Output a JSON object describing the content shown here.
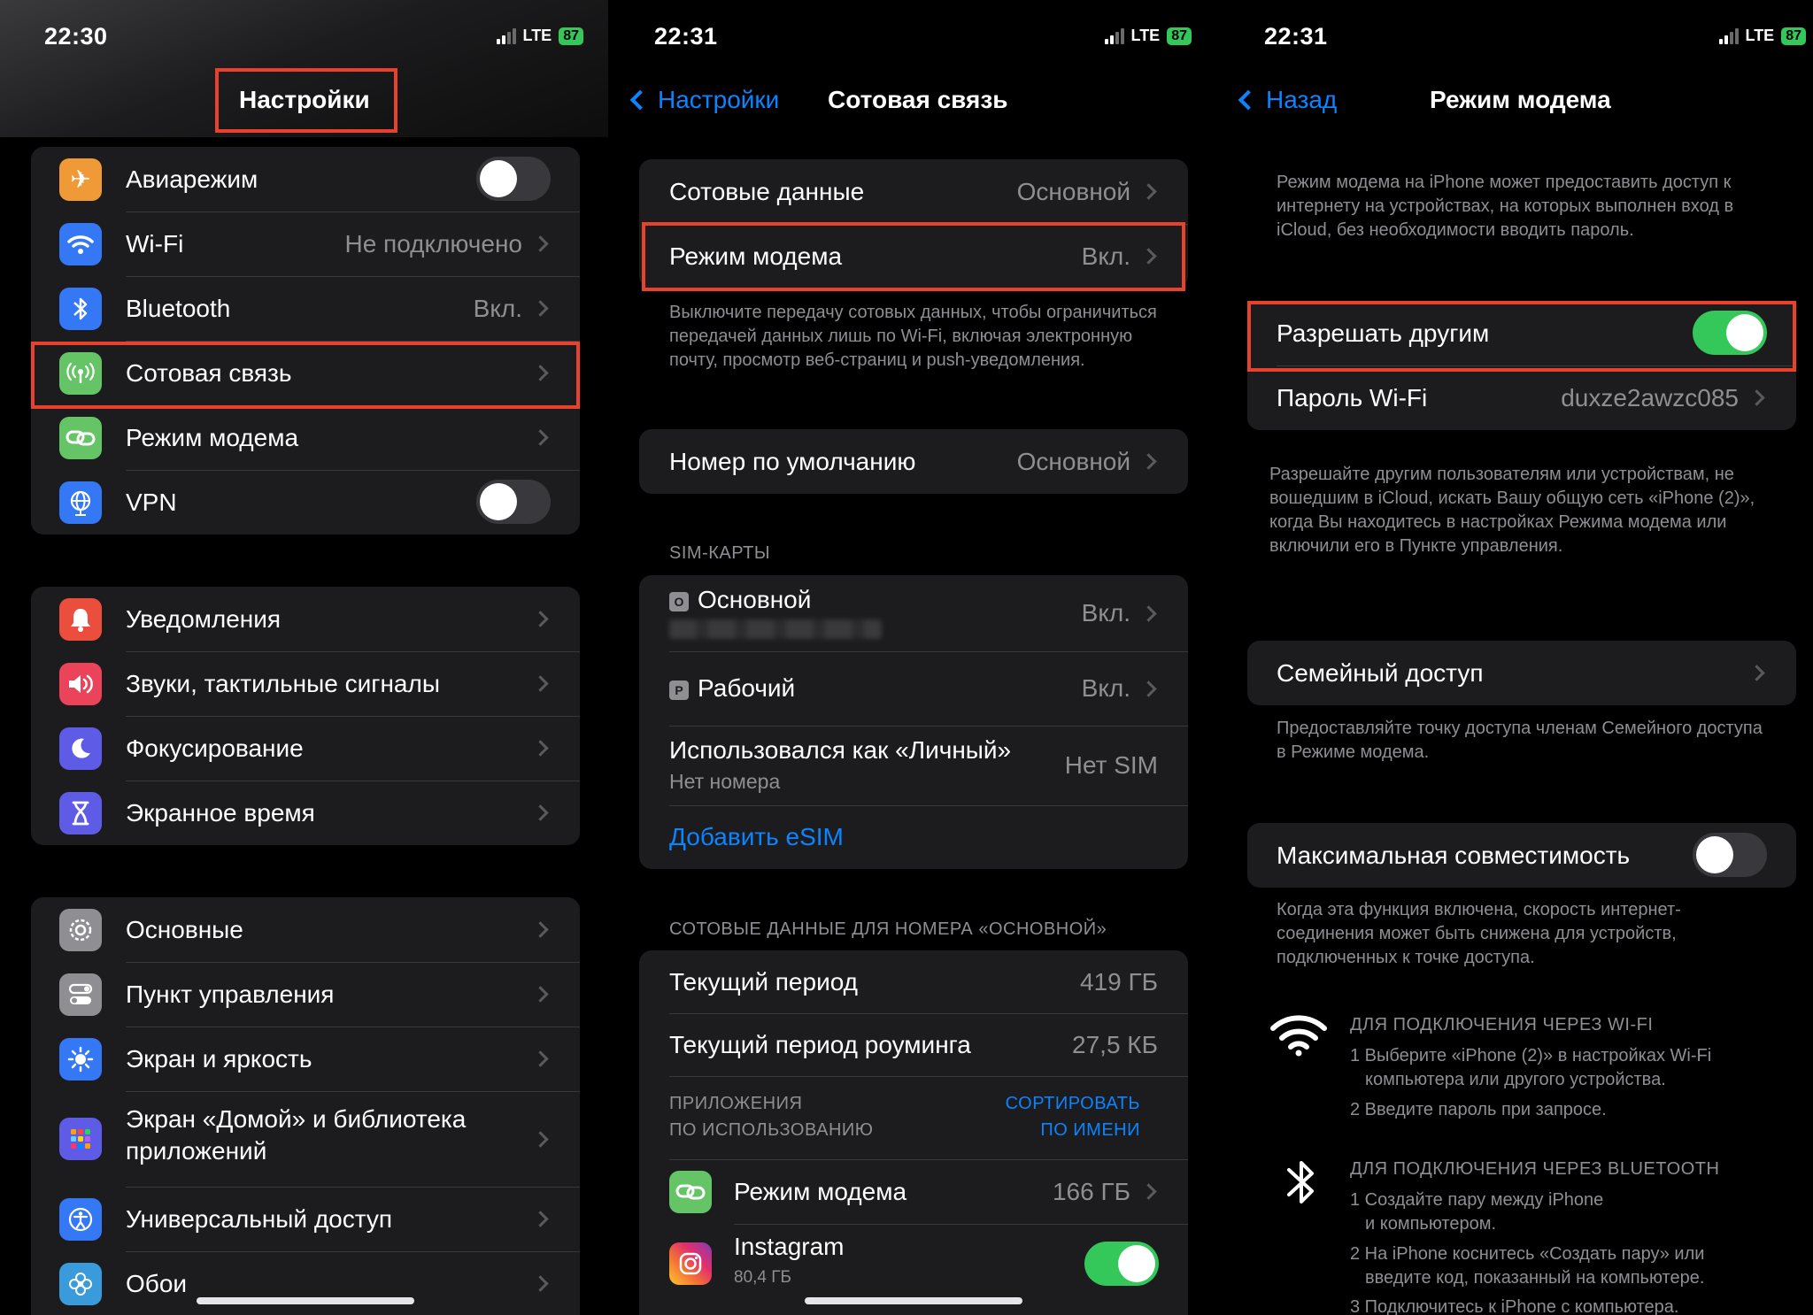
{
  "status": {
    "p1_time": "22:30",
    "p2_time": "22:31",
    "p3_time": "22:31",
    "network": "LTE",
    "battery": "87"
  },
  "colors": {
    "accent": "#0a84ff",
    "toggle_on": "#34c759",
    "highlight_box": "#e8412c",
    "cell_bg": "#1c1c1e"
  },
  "settings": {
    "title": "Настройки",
    "group1": [
      {
        "label": "Авиарежим",
        "icon": "airplane-icon",
        "color": "#f09a37",
        "toggle": false
      },
      {
        "label": "Wi-Fi",
        "value": "Не подключено",
        "icon": "wifi-icon",
        "color": "#3478f6"
      },
      {
        "label": "Bluetooth",
        "value": "Вкл.",
        "icon": "bluetooth-icon",
        "color": "#3478f6"
      },
      {
        "label": "Сотовая связь",
        "icon": "antenna-icon",
        "color": "#65c466"
      },
      {
        "label": "Режим модема",
        "icon": "chain-link-icon",
        "color": "#65c466"
      },
      {
        "label": "VPN",
        "icon": "globe-icon",
        "color": "#3478f6",
        "toggle": false
      }
    ],
    "group2": [
      {
        "label": "Уведомления",
        "icon": "bell-icon",
        "color": "#eb4e3d"
      },
      {
        "label": "Звуки, тактильные сигналы",
        "icon": "speaker-icon",
        "color": "#eb445a"
      },
      {
        "label": "Фокусирование",
        "icon": "moon-icon",
        "color": "#5e5ce6"
      },
      {
        "label": "Экранное время",
        "icon": "hourglass-icon",
        "color": "#5e5ce6"
      }
    ],
    "group3": [
      {
        "label": "Основные",
        "icon": "gear-icon",
        "color": "#8e8e93"
      },
      {
        "label": "Пункт управления",
        "icon": "switches-icon",
        "color": "#8e8e93"
      },
      {
        "label": "Экран и яркость",
        "icon": "sun-icon",
        "color": "#3478f6"
      },
      {
        "label": "Экран «Домой» и библиотека",
        "label2": "приложений",
        "icon": "app-grid-icon",
        "color": "#5e5ce6"
      },
      {
        "label": "Универсальный доступ",
        "icon": "accessibility-icon",
        "color": "#3478f6"
      },
      {
        "label": "Обои",
        "icon": "flower-icon",
        "color": "#3a9bdc"
      }
    ]
  },
  "cellular": {
    "back_label": "Настройки",
    "title": "Сотовая связь",
    "rows1": [
      {
        "label": "Сотовые данные",
        "value": "Основной"
      },
      {
        "label": "Режим модема",
        "value": "Вкл."
      }
    ],
    "note1": "Выключите передачу сотовых данных, чтобы ограничиться передачей данных лишь по Wi-Fi, включая электронную почту, просмотр веб-страниц и push-уведомления.",
    "default_number": {
      "label": "Номер по умолчанию",
      "value": "Основной"
    },
    "sim_header": "SIM-КАРТЫ",
    "sims": [
      {
        "tag": "O",
        "label": "Основной",
        "value": "Вкл."
      },
      {
        "tag": "P",
        "label": "Рабочий",
        "value": "Вкл."
      }
    ],
    "personal": {
      "label": "Использовался как «Личный»",
      "sub": "Нет номера",
      "value": "Нет SIM"
    },
    "add_esim": "Добавить eSIM",
    "data_header": "СОТОВЫЕ ДАННЫЕ ДЛЯ НОМЕРА «ОСНОВНОЙ»",
    "current_period": {
      "label": "Текущий период",
      "value": "419 ГБ"
    },
    "roaming_period": {
      "label": "Текущий период роуминга",
      "value": "27,5 КБ"
    },
    "apps_header_1": "ПРИЛОЖЕНИЯ",
    "apps_header_2": "ПО ИСПОЛЬЗОВАНИЮ",
    "sort_1": "СОРТИРОВАТЬ",
    "sort_2": "ПО ИМЕНИ",
    "apps": [
      {
        "label": "Режим модема",
        "value": "166 ГБ",
        "icon": "chain-link-icon"
      },
      {
        "label": "Instagram",
        "sub": "80,4 ГБ",
        "icon": "instagram-icon",
        "toggle": true
      }
    ]
  },
  "hotspot": {
    "back_label": "Назад",
    "title": "Режим модема",
    "intro": "Режим модема на iPhone может предоставить доступ к интернету на устройствах, на которых выполнен вход в iCloud, без необходимости вводить пароль.",
    "allow_others": {
      "label": "Разрешать другим",
      "toggle": true
    },
    "wifi_password": {
      "label": "Пароль Wi-Fi",
      "value": "duxze2awzc085"
    },
    "note_allow": "Разрешайте другим пользователям или устройствам, не вошедшим в iCloud, искать Вашу общую сеть «iPhone (2)», когда Вы находитесь в настройках Режима модема или включили его в Пункте управления.",
    "family": {
      "label": "Семейный доступ"
    },
    "note_family": "Предоставляйте точку доступа членам Семейного доступа в Режиме модема.",
    "max_compat": {
      "label": "Максимальная совместимость",
      "toggle": false
    },
    "note_compat": "Когда эта функция включена, скорость интернет-соединения может быть снижена для устройств, подключенных к точке доступа.",
    "wifi_header": "ДЛЯ ПОДКЛЮЧЕНИЯ ЧЕРЕЗ WI-FI",
    "wifi_steps": [
      "1 Выберите «iPhone (2)» в настройках Wi-Fi",
      "компьютера или другого устройства.",
      "2 Введите пароль при запросе."
    ],
    "bt_header": "ДЛЯ ПОДКЛЮЧЕНИЯ ЧЕРЕЗ BLUETOOTH",
    "bt_steps": [
      "1 Создайте пару между iPhone",
      "и компьютером.",
      "2 На iPhone коснитесь «Создать пару» или",
      "введите код, показанный на компьютере.",
      "3 Подключитесь к iPhone с компьютера."
    ]
  }
}
